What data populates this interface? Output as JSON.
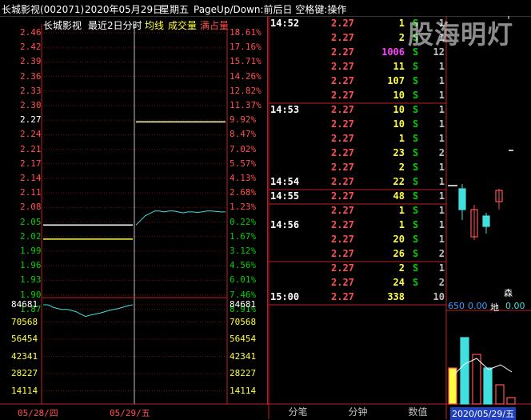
{
  "header": {
    "stock": "长城影视(002071)",
    "date": "2020年05月29日",
    "weekday": "星期五",
    "hint": "PageUp/Down:前后日 空格键:操作"
  },
  "chart_legend": {
    "name": "长城影视",
    "period": "最近2日分时",
    "avg_label": "均线",
    "vol_label": "成交量",
    "extra_label": "满占量"
  },
  "watermark": "股海明灯",
  "colors": {
    "price_line": "#40e0e0",
    "avg_line": "#ffff40",
    "up": "#ff5050",
    "down": "#00d000",
    "grid": "#c02020"
  },
  "chart_data": {
    "type": "line",
    "price_ticks": [
      "2.46",
      "2.42",
      "2.39",
      "2.36",
      "2.33",
      "2.30",
      "2.27",
      "2.24",
      "2.21",
      "2.17",
      "2.14",
      "2.11",
      "2.08",
      "2.05",
      "2.02",
      "1.99",
      "1.96",
      "1.93",
      "1.90",
      "1.87"
    ],
    "pct_ticks": [
      "18.61%",
      "17.16%",
      "15.71%",
      "14.26%",
      "12.82%",
      "11.37%",
      "9.92%",
      "8.47%",
      "7.02%",
      "5.57%",
      "4.13%",
      "2.68%",
      "1.23%",
      "0.22%",
      "1.67%",
      "3.12%",
      "4.56%",
      "6.01%",
      "7.46%",
      "8.91%"
    ],
    "volume_ticks": [
      "84681",
      "70568",
      "56454",
      "42341",
      "28227",
      "14114"
    ],
    "x_labels": [
      "05/28/四",
      "05/29/五"
    ],
    "ylim": [
      1.87,
      2.46
    ],
    "series": [
      {
        "day": "05/28",
        "price": [
          1.88,
          1.88,
          1.875,
          1.872,
          1.87,
          1.87,
          1.868,
          1.865,
          1.86,
          1.855,
          1.858,
          1.86,
          1.862,
          1.865,
          1.868,
          1.87,
          1.872,
          1.875,
          1.878,
          1.88
        ],
        "avg": [
          2.02,
          2.02,
          2.02,
          2.02,
          2.02,
          2.02,
          2.02,
          2.02,
          2.02,
          2.02,
          2.02,
          2.02,
          2.02,
          2.02,
          2.02,
          2.02,
          2.02,
          2.02,
          2.02,
          2.02
        ]
      },
      {
        "day": "05/29",
        "price": [
          2.05,
          2.06,
          2.07,
          2.075,
          2.08,
          2.08,
          2.078,
          2.08,
          2.08,
          2.078,
          2.076,
          2.078,
          2.078,
          2.077,
          2.078,
          2.08,
          2.08,
          2.079,
          2.078,
          2.078
        ],
        "avg": [
          2.27,
          2.27,
          2.27,
          2.27,
          2.27,
          2.27,
          2.27,
          2.27,
          2.27,
          2.27,
          2.27,
          2.27,
          2.27,
          2.27,
          2.27,
          2.27,
          2.27,
          2.27,
          2.27,
          2.27
        ]
      }
    ]
  },
  "trades": [
    {
      "time": "14:52",
      "price": "2.27",
      "vol": "1",
      "side": "S",
      "n": "1"
    },
    {
      "time": "",
      "price": "2.27",
      "vol": "2",
      "side": "S",
      "n": "1"
    },
    {
      "time": "",
      "price": "2.27",
      "vol": "1006",
      "side": "S",
      "n": "12"
    },
    {
      "time": "",
      "price": "2.27",
      "vol": "11",
      "side": "S",
      "n": "1"
    },
    {
      "time": "",
      "price": "2.27",
      "vol": "107",
      "side": "S",
      "n": "1"
    },
    {
      "time": "",
      "price": "2.27",
      "vol": "10",
      "side": "S",
      "n": "1"
    },
    {
      "time": "14:53",
      "price": "2.27",
      "vol": "10",
      "side": "S",
      "n": "1"
    },
    {
      "time": "",
      "price": "2.27",
      "vol": "10",
      "side": "S",
      "n": "1"
    },
    {
      "time": "",
      "price": "2.27",
      "vol": "1",
      "side": "S",
      "n": "1"
    },
    {
      "time": "",
      "price": "2.27",
      "vol": "23",
      "side": "S",
      "n": "2"
    },
    {
      "time": "",
      "price": "2.27",
      "vol": "2",
      "side": "S",
      "n": "1"
    },
    {
      "time": "14:54",
      "price": "2.27",
      "vol": "22",
      "side": "S",
      "n": "1"
    },
    {
      "time": "14:55",
      "price": "2.27",
      "vol": "48",
      "side": "S",
      "n": "1"
    },
    {
      "time": "",
      "price": "2.27",
      "vol": "1",
      "side": "S",
      "n": "1"
    },
    {
      "time": "14:56",
      "price": "2.27",
      "vol": "1",
      "side": "S",
      "n": "1"
    },
    {
      "time": "",
      "price": "2.27",
      "vol": "20",
      "side": "S",
      "n": "1"
    },
    {
      "time": "",
      "price": "2.27",
      "vol": "26",
      "side": "S",
      "n": "2"
    },
    {
      "time": "",
      "price": "2.27",
      "vol": "2",
      "side": "S",
      "n": "1"
    },
    {
      "time": "",
      "price": "2.27",
      "vol": "24",
      "side": "S",
      "n": "2"
    },
    {
      "time": "15:00",
      "price": "2.27",
      "vol": "338",
      "side": "",
      "n": "10"
    }
  ],
  "tabs": [
    "分笔",
    "分钟",
    "数值"
  ],
  "right_panel": {
    "label_a": "650",
    "val_a": "0.00",
    "label_b": "地",
    "val_b": "0.00",
    "corner": "森",
    "date": "2020/05/29/五"
  }
}
